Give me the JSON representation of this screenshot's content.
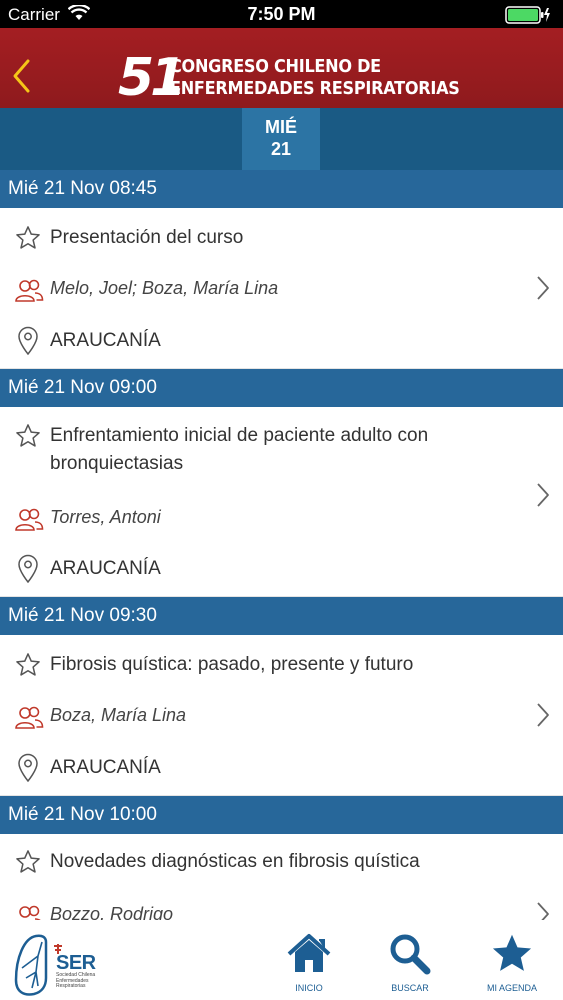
{
  "status_bar": {
    "carrier": "Carrier",
    "time": "7:50 PM"
  },
  "header": {
    "logo_number": "51",
    "logo_line1": "CONGRESO CHILENO DE",
    "logo_line2": "ENFERMEDADES RESPIRATORIAS",
    "accent_color": "#a41e22"
  },
  "day_tab": {
    "weekday": "MIÉ",
    "day": "21"
  },
  "sessions": [
    {
      "header": "Mié 21 Nov 08:45",
      "title": "Presentación del curso",
      "speakers": "Melo, Joel; Boza, María Lina",
      "place": "ARAUCANÍA"
    },
    {
      "header": "Mié 21 Nov 09:00",
      "title": "Enfrentamiento inicial de paciente adulto con bronquiectasias",
      "speakers": "Torres, Antoni",
      "place": "ARAUCANÍA"
    },
    {
      "header": "Mié 21 Nov 09:30",
      "title": "Fibrosis quística: pasado, presente y futuro",
      "speakers": "Boza, María Lina",
      "place": "ARAUCANÍA"
    },
    {
      "header": "Mié 21 Nov 10:00",
      "title": "Novedades diagnósticas en fibrosis quística",
      "speakers": "Bozzo, Rodrigo",
      "place": ""
    }
  ],
  "tab_bar": {
    "logo_text": "SER",
    "logo_subtitle_1": "Sociedad Chilena",
    "logo_subtitle_2": "Enfermedades",
    "logo_subtitle_3": "Respiratorias",
    "inicio": "INICIO",
    "buscar": "BUSCAR",
    "agenda": "MI AGENDA"
  },
  "colors": {
    "section": "#27679a",
    "day_bar": "#1a5a84",
    "icon_red": "#c0392b",
    "tab_blue": "#1d5e93"
  }
}
